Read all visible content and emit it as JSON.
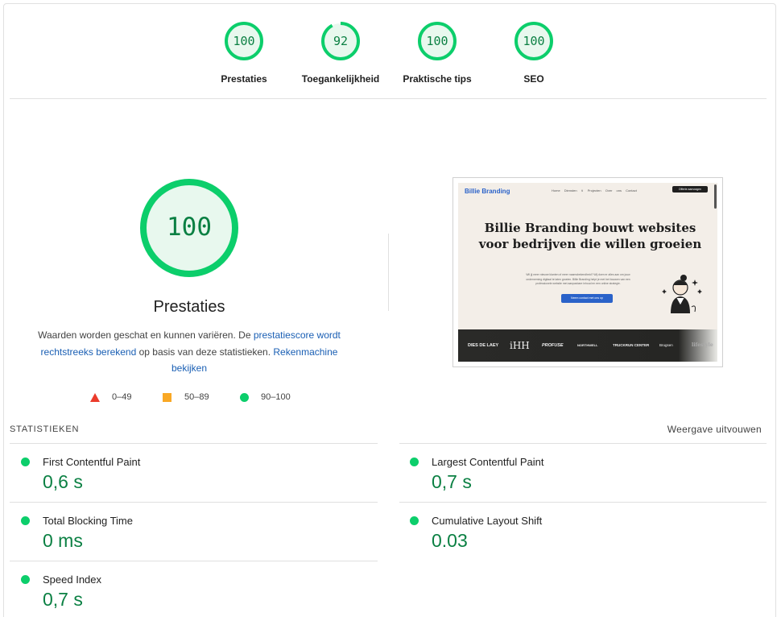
{
  "top_scores": [
    {
      "label": "Prestaties",
      "score": "100",
      "value": 100
    },
    {
      "label": "Toegankelijkheid",
      "score": "92",
      "value": 92
    },
    {
      "label": "Praktische tips",
      "score": "100",
      "value": 100
    },
    {
      "label": "SEO",
      "score": "100",
      "value": 100
    }
  ],
  "performance": {
    "score": "100",
    "value": 100,
    "title": "Prestaties",
    "desc_part1": "Waarden worden geschat en kunnen variëren. De ",
    "desc_link1": "prestatiescore wordt rechtstreeks berekend",
    "desc_part2": " op basis van deze statistieken. ",
    "desc_link2": "Rekenmachine bekijken"
  },
  "legend": [
    {
      "range": "0–49",
      "shape": "triangle",
      "color": "#eb3b2b"
    },
    {
      "range": "50–89",
      "shape": "square",
      "color": "#f9a825"
    },
    {
      "range": "90–100",
      "shape": "circle",
      "color": "#0cce6b"
    }
  ],
  "thumbnail": {
    "brand": "Billie Branding",
    "nav": "Home Diensten ∨ Projecten Over ons Contact",
    "cta": "Offerte aanvragen",
    "heading": "Billie Branding bouwt websites voor bedrijven die willen groeien",
    "paragraph": "Wil jij meer nieuwe klanten of meer naamsbekendheid? Wij doen er alles aan om jouw onderneming digitaal te laten groeien. Billie Branding helpt je met het bouwen van een professionele website met aanpasbare inhoud en een online strategie.",
    "button": "Neem contact met ons op",
    "logos": [
      "DIES DE LAEY",
      "iHH",
      "PROFUSE",
      "NORTHWELL",
      "TRUCKRUN CENTER",
      "Brugsen",
      "lifestyle"
    ]
  },
  "stats": {
    "header": "STATISTIEKEN",
    "expand": "Weergave uitvouwen",
    "metrics": [
      {
        "label": "First Contentful Paint",
        "value": "0,6 s"
      },
      {
        "label": "Largest Contentful Paint",
        "value": "0,7 s"
      },
      {
        "label": "Total Blocking Time",
        "value": "0 ms"
      },
      {
        "label": "Cumulative Layout Shift",
        "value": "0.03"
      },
      {
        "label": "Speed Index",
        "value": "0,7 s"
      }
    ]
  },
  "colors": {
    "pass": "#0cce6b",
    "pass_text": "#0b8043",
    "pass_fill": "#e8f8ee",
    "link": "#1a5fb4"
  }
}
